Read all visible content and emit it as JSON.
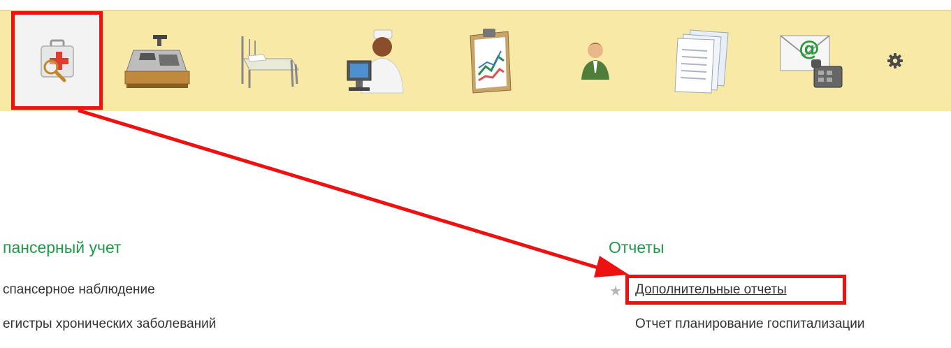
{
  "toolbar": {
    "items": [
      {
        "name": "medical-kit",
        "active": true
      },
      {
        "name": "cash-register",
        "active": false
      },
      {
        "name": "hospital-bed",
        "active": false
      },
      {
        "name": "nurse-computer",
        "active": false
      },
      {
        "name": "clipboard-chart",
        "active": false
      },
      {
        "name": "person",
        "active": false
      },
      {
        "name": "documents",
        "active": false
      },
      {
        "name": "email-phone",
        "active": false
      },
      {
        "name": "settings",
        "active": false
      }
    ]
  },
  "sections": {
    "left": {
      "title": "пансерный учет",
      "items": [
        "спансерное наблюдение",
        "егистры хронических заболеваний"
      ]
    },
    "right": {
      "title": "Отчеты",
      "items": [
        "Дополнительные отчеты",
        "Отчет планирование госпитализации"
      ]
    }
  },
  "colors": {
    "toolbar_bg": "#f9e9a6",
    "section_title": "#1e9a4a",
    "highlight": "#ee1111"
  }
}
